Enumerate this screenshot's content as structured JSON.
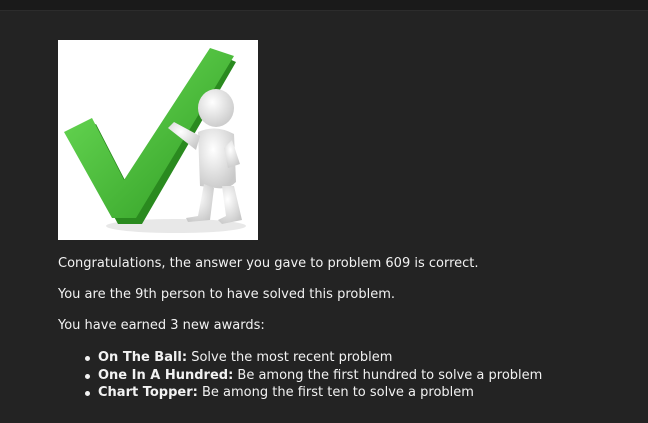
{
  "illustration": {
    "icon": "checkmark-with-figure-icon",
    "check_color": "#3fbf2f",
    "figure_color": "#e6e6e6"
  },
  "message": {
    "congrats": "Congratulations, the answer you gave to problem 609 is correct.",
    "solver_rank": "You are the 9th person to have solved this problem.",
    "awards_intro": "You have earned 3 new awards:"
  },
  "awards": [
    {
      "name": "On The Ball:",
      "description": " Solve the most recent problem"
    },
    {
      "name": "One In A Hundred:",
      "description": " Be among the first hundred to solve a problem"
    },
    {
      "name": "Chart Topper:",
      "description": " Be among the first ten to solve a problem"
    }
  ],
  "colors": {
    "background": "#232323",
    "text": "#f2f2f2"
  }
}
